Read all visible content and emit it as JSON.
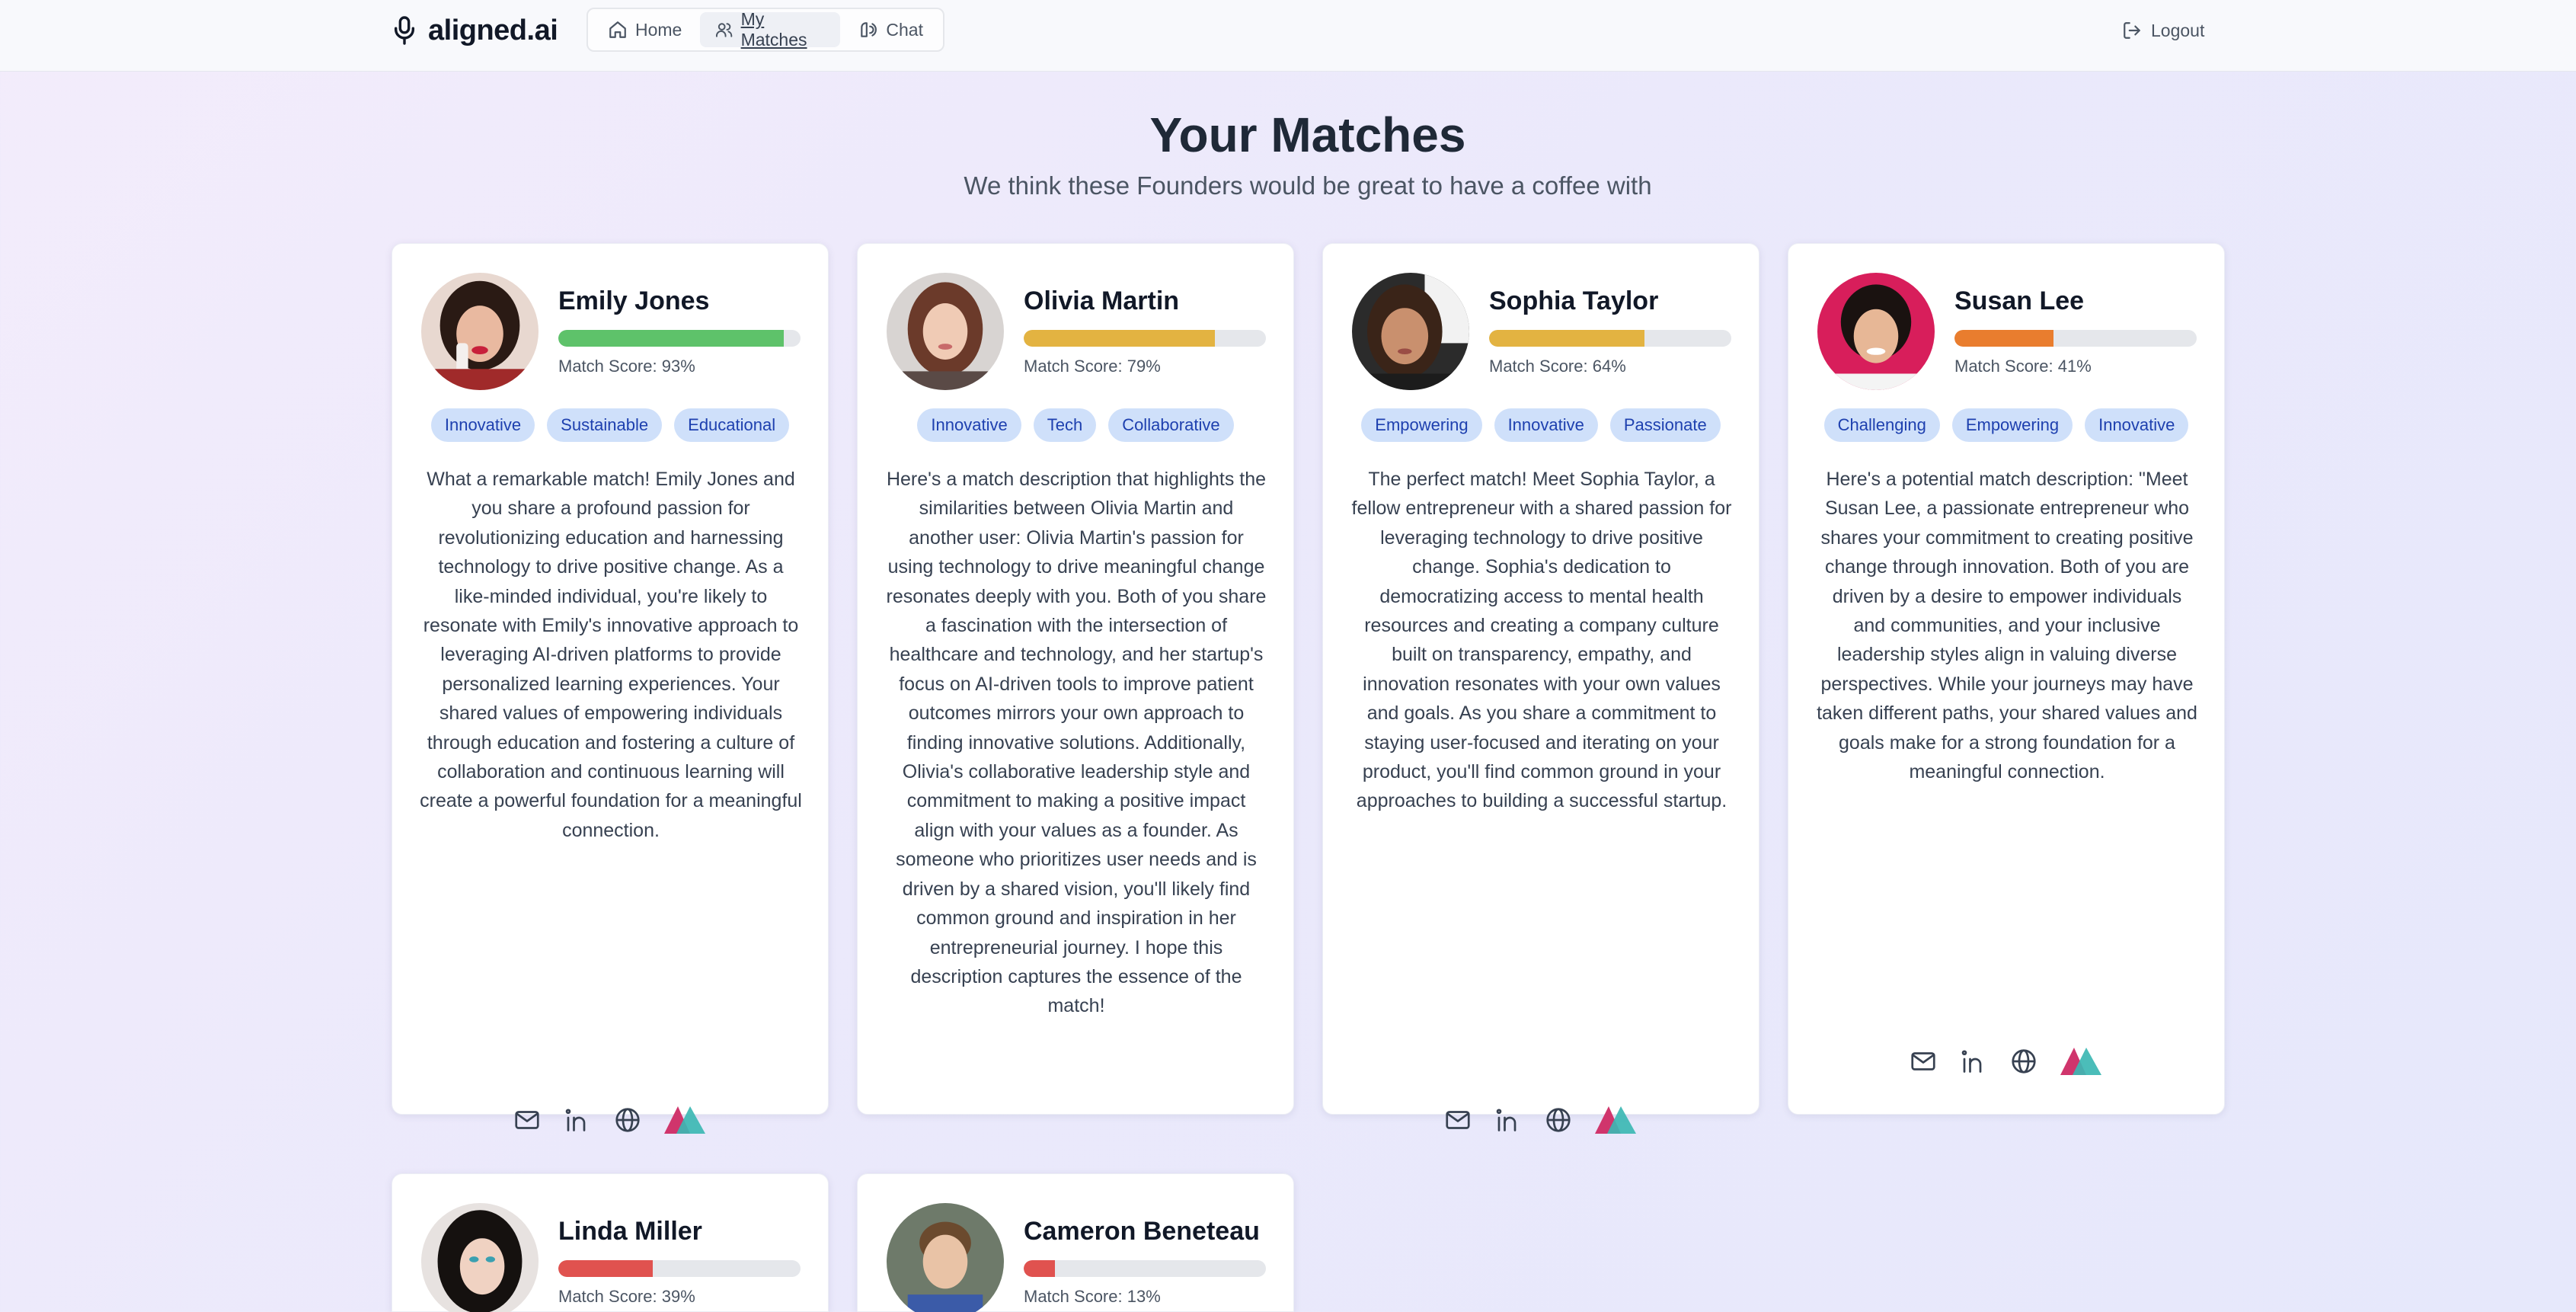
{
  "brand": {
    "name": "aligned.ai"
  },
  "nav": {
    "home": "Home",
    "matches": "My Matches",
    "chat": "Chat",
    "logout": "Logout"
  },
  "header": {
    "title": "Your Matches",
    "subtitle": "We think these Founders would be great to have a coffee with"
  },
  "colors": {
    "high": "#5ec26a",
    "mid": "#e3b341",
    "low": "#e97d2e",
    "poor": "#e0524f",
    "tag_bg": "#cfe0fa",
    "tag_text": "#1e40af"
  },
  "matches": [
    {
      "name": "Emily Jones",
      "score": 93,
      "score_label": "Match Score: 93%",
      "tags": [
        "Innovative",
        "Sustainable",
        "Educational"
      ],
      "description": "What a remarkable match! Emily Jones and you share a profound passion for revolutionizing education and harnessing technology to drive positive change. As a like-minded individual, you're likely to resonate with Emily's innovative approach to leveraging AI-driven platforms to provide personalized learning experiences. Your shared values of empowering individuals through education and fostering a culture of collaboration and continuous learning will create a powerful foundation for a meaningful connection."
    },
    {
      "name": "Olivia Martin",
      "score": 79,
      "score_label": "Match Score: 79%",
      "tags": [
        "Innovative",
        "Tech",
        "Collaborative"
      ],
      "description": "Here's a match description that highlights the similarities between Olivia Martin and another user: Olivia Martin's passion for using technology to drive meaningful change resonates deeply with you. Both of you share a fascination with the intersection of healthcare and technology, and her startup's focus on AI-driven tools to improve patient outcomes mirrors your own approach to finding innovative solutions. Additionally, Olivia's collaborative leadership style and commitment to making a positive impact align with your values as a founder. As someone who prioritizes user needs and is driven by a shared vision, you'll likely find common ground and inspiration in her entrepreneurial journey. I hope this description captures the essence of the match!"
    },
    {
      "name": "Sophia Taylor",
      "score": 64,
      "score_label": "Match Score: 64%",
      "tags": [
        "Empowering",
        "Innovative",
        "Passionate"
      ],
      "description": "The perfect match! Meet Sophia Taylor, a fellow entrepreneur with a shared passion for leveraging technology to drive positive change. Sophia's dedication to democratizing access to mental health resources and creating a company culture built on transparency, empathy, and innovation resonates with your own values and goals. As you share a commitment to staying user-focused and iterating on your product, you'll find common ground in your approaches to building a successful startup."
    },
    {
      "name": "Susan Lee",
      "score": 41,
      "score_label": "Match Score: 41%",
      "tags": [
        "Challenging",
        "Empowering",
        "Innovative"
      ],
      "description": "Here's a potential match description: \"Meet Susan Lee, a passionate entrepreneur who shares your commitment to creating positive change through innovation. Both of you are driven by a desire to empower individuals and communities, and your inclusive leadership styles align in valuing diverse perspectives. While your journeys may have taken different paths, your shared values and goals make for a strong foundation for a meaningful connection."
    },
    {
      "name": "Linda Miller",
      "score": 39,
      "score_label": "Match Score: 39%"
    },
    {
      "name": "Cameron Beneteau",
      "score": 13,
      "score_label": "Match Score: 13%"
    }
  ]
}
